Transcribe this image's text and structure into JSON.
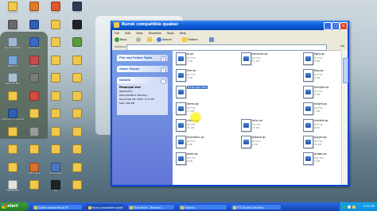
{
  "desktop": {
    "icons": [
      {
        "label": "My Docs",
        "color": "#f2c84b"
      },
      {
        "label": "Blender",
        "color": "#e07a2a"
      },
      {
        "label": "Firefox",
        "color": "#e3572b"
      },
      {
        "label": "Steam",
        "color": "#2d3b55"
      },
      {
        "label": "Hammer",
        "color": "#6a6a6a"
      },
      {
        "label": "",
        "color": "#2e5fb7"
      },
      {
        "label": "",
        "color": "#f2c84b"
      },
      {
        "label": "3D",
        "color": "#222222"
      },
      {
        "label": "My Computer",
        "color": "#9fb6d3"
      },
      {
        "label": "Audacity",
        "color": "#3869c6"
      },
      {
        "label": "",
        "color": "#f2c84b"
      },
      {
        "label": "",
        "color": "#5b9c3a"
      },
      {
        "label": "Network",
        "color": "#7aa6d9"
      },
      {
        "label": "Paint",
        "color": "#c94a4a"
      },
      {
        "label": "",
        "color": "#f2c84b"
      },
      {
        "label": "",
        "color": "#f2c84b"
      },
      {
        "label": "Recycle Bin",
        "color": "#a7c0cf"
      },
      {
        "label": "",
        "color": "#7a7a7a"
      },
      {
        "label": "",
        "color": "#f2c84b"
      },
      {
        "label": "",
        "color": "#f2c84b"
      },
      {
        "label": "",
        "color": "#f2c84b"
      },
      {
        "label": "",
        "color": "#d64b3b"
      },
      {
        "label": "",
        "color": "#f2c84b"
      },
      {
        "label": "",
        "color": "#f2c84b"
      },
      {
        "label": "shortcut to audacity.exe",
        "color": "#2f5fb0"
      },
      {
        "label": "",
        "color": "#f2c84b"
      },
      {
        "label": "",
        "color": "#f2c84b"
      },
      {
        "label": "",
        "color": "#f2c84b"
      },
      {
        "label": "",
        "color": "#f2c84b"
      },
      {
        "label": "",
        "color": "#9a9a9a"
      },
      {
        "label": "",
        "color": "#f2c84b"
      },
      {
        "label": "",
        "color": "#f2c84b"
      },
      {
        "label": "",
        "color": "#f2c84b"
      },
      {
        "label": "",
        "color": "#f2c84b"
      },
      {
        "label": "",
        "color": "#f2c84b"
      },
      {
        "label": "",
        "color": "#f2c84b"
      },
      {
        "label": "",
        "color": "#f2c84b"
      },
      {
        "label": "Half-Life 2",
        "color": "#d6702c"
      },
      {
        "label": "ac3 Lame",
        "color": "#4a77c2"
      },
      {
        "label": "",
        "color": "#f2c84b"
      },
      {
        "label": "FROST.PNF",
        "color": "#e2e2e2"
      },
      {
        "label": "",
        "color": "#f2c84b"
      },
      {
        "label": "3D",
        "color": "#222222"
      },
      {
        "label": "",
        "color": "#f2c84b"
      }
    ]
  },
  "window": {
    "title": "Rurok compatible quakec",
    "menu": [
      "File",
      "Edit",
      "View",
      "Favorites",
      "Tools",
      "Help"
    ],
    "toolbar": {
      "back": "Back",
      "search": "Search",
      "folders": "Folders"
    },
    "address_label": "Address",
    "go_label": "Go",
    "taskpane": {
      "sections": [
        {
          "title": "File and Folder Tasks"
        },
        {
          "title": "Other Places"
        },
        {
          "title": "Details"
        }
      ],
      "details": {
        "name": "fteqccgui.exe",
        "type": "Application",
        "modified_label": "Date Modified: Monday,",
        "modified_date": "December 26, 2005, 9:31 PM",
        "size": "Size: 260 KB"
      }
    },
    "files": [
      {
        "name": "ai.qc",
        "type": "QC File",
        "size": "3 KB"
      },
      {
        "name": "enforcer.qc",
        "type": "QC File",
        "size": "11 KB"
      },
      {
        "name": "fight.qc",
        "type": "QC File",
        "size": "5 KB"
      },
      {
        "name": "fish.qc",
        "type": "QC File",
        "size": "5 KB"
      },
      {
        "name": "flag.qc",
        "type": "QC File",
        "size": "6 KB"
      },
      {
        "name": "fteqccgui.exe",
        "type": "",
        "size": "",
        "selected": true
      },
      {
        "name": "hknight.qc",
        "type": "QC File",
        "size": "9 KB"
      },
      {
        "name": "items.qc",
        "type": "QC File",
        "size": "17 KB"
      },
      {
        "name": "knight.qc",
        "type": "QC File",
        "size": "7 KB"
      },
      {
        "name": "client.qc",
        "type": "QC File",
        "size": "21 KB"
      },
      {
        "name": "misc.qc",
        "type": "QC File",
        "size": "13 KB"
      },
      {
        "name": "models.qc",
        "type": "QC File",
        "size": "8 KB"
      },
      {
        "name": "monsters.qc",
        "type": "QC File",
        "size": "6 KB"
      },
      {
        "name": "oldone.qc",
        "type": "QC File",
        "size": "6 KB"
      },
      {
        "name": "player.qc",
        "type": "QC File",
        "size": "19 KB"
      },
      {
        "name": "plats.qc",
        "type": "QC File",
        "size": "8 KB"
      },
      {
        "name": "progs.src",
        "type": "SRC File",
        "size": "1 KB"
      }
    ]
  },
  "taskbar": {
    "start_label": "start",
    "items": [
      {
        "label": "Quake compat Rurok PC"
      },
      {
        "label": "Rurok compatible quakec",
        "active": true
      },
      {
        "label": "Firox Beum - Ravamp..."
      },
      {
        "label": "Flashing"
      },
      {
        "label": "FTE Quake2 Develop..."
      }
    ],
    "clock": "9:34 AM"
  }
}
